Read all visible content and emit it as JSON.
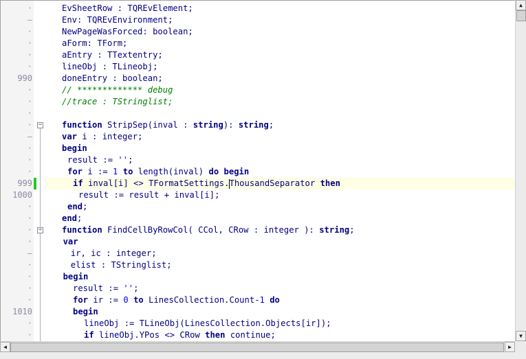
{
  "editor": {
    "lines": [
      {
        "num": "",
        "marker": "·",
        "indent": 1,
        "tokens": [
          [
            "id",
            "EvSheetRow : TQREvElement;"
          ]
        ]
      },
      {
        "num": "",
        "marker": "–",
        "indent": 1,
        "tokens": [
          [
            "id",
            "Env: TQREvEnvironment;"
          ]
        ]
      },
      {
        "num": "",
        "marker": "·",
        "indent": 1,
        "tokens": [
          [
            "id",
            "NewPageWasForced: boolean;"
          ]
        ]
      },
      {
        "num": "",
        "marker": "·",
        "indent": 1,
        "tokens": [
          [
            "id",
            "aForm: TForm;"
          ]
        ]
      },
      {
        "num": "",
        "marker": "·",
        "indent": 1,
        "tokens": [
          [
            "id",
            "aEntry : TTextentry;"
          ]
        ]
      },
      {
        "num": "",
        "marker": "·",
        "indent": 1,
        "tokens": [
          [
            "id",
            "lineObj : TLineobj;"
          ]
        ]
      },
      {
        "num": "990",
        "marker": "",
        "indent": 1,
        "tokens": [
          [
            "id",
            "doneEntry : boolean;"
          ]
        ]
      },
      {
        "num": "",
        "marker": "·",
        "indent": 1,
        "tokens": [
          [
            "cmt",
            "// ************* debug"
          ]
        ]
      },
      {
        "num": "",
        "marker": "·",
        "indent": 1,
        "tokens": [
          [
            "cmt",
            "//trace : TStringlist;"
          ]
        ]
      },
      {
        "num": "",
        "marker": "·",
        "indent": 0,
        "tokens": []
      },
      {
        "num": "",
        "marker": "·",
        "indent": 1,
        "fold": "−",
        "tokens": [
          [
            "kw",
            "function"
          ],
          [
            "id",
            " StripSep(inval : "
          ],
          [
            "kw",
            "string"
          ],
          [
            "id",
            "): "
          ],
          [
            "kw",
            "string"
          ],
          [
            "id",
            ";"
          ]
        ]
      },
      {
        "num": "",
        "marker": "–",
        "indent": 1,
        "tokens": [
          [
            "kw",
            "var"
          ],
          [
            "id",
            " i : integer;"
          ]
        ]
      },
      {
        "num": "",
        "marker": "·",
        "indent": 1,
        "tokens": [
          [
            "kw",
            "begin"
          ]
        ]
      },
      {
        "num": "",
        "marker": "·",
        "indent": 2,
        "tokens": [
          [
            "id",
            "result := "
          ],
          [
            "str",
            "''"
          ],
          [
            "id",
            ";"
          ]
        ]
      },
      {
        "num": "",
        "marker": "·",
        "indent": 2,
        "tokens": [
          [
            "kw",
            "for"
          ],
          [
            "id",
            " i := "
          ],
          [
            "num",
            "1"
          ],
          [
            "id",
            " "
          ],
          [
            "kw",
            "to"
          ],
          [
            "id",
            " length(inval) "
          ],
          [
            "kw",
            "do"
          ],
          [
            "id",
            " "
          ],
          [
            "kw",
            "begin"
          ]
        ]
      },
      {
        "num": "999",
        "marker": "",
        "indent": 3,
        "highlight": true,
        "change": true,
        "tokens": [
          [
            "kw",
            "if"
          ],
          [
            "id",
            " inval[i] <> TFormatSettings."
          ],
          [
            "caret",
            ""
          ],
          [
            "id",
            "ThousandSeparator "
          ],
          [
            "kw",
            "then"
          ]
        ]
      },
      {
        "num": "1000",
        "marker": "",
        "indent": 4,
        "tokens": [
          [
            "id",
            "result := result + inval[i];"
          ]
        ]
      },
      {
        "num": "",
        "marker": "·",
        "indent": 2,
        "tokens": [
          [
            "kw",
            "end"
          ],
          [
            "id",
            ";"
          ]
        ]
      },
      {
        "num": "",
        "marker": "·",
        "indent": 1,
        "tokens": [
          [
            "kw",
            "end"
          ],
          [
            "id",
            ";"
          ]
        ]
      },
      {
        "num": "",
        "marker": "·",
        "indent": 1,
        "fold": "−",
        "tokens": [
          [
            "kw",
            "function"
          ],
          [
            "id",
            " FindCellByRowCol( CCol, CRow : integer ): "
          ],
          [
            "kw",
            "string"
          ],
          [
            "id",
            ";"
          ]
        ]
      },
      {
        "num": "",
        "marker": "·",
        "indent": 1.2,
        "tokens": [
          [
            "kw",
            "var"
          ]
        ]
      },
      {
        "num": "",
        "marker": "–",
        "indent": 2.6,
        "tokens": [
          [
            "id",
            "ir, ic : integer;"
          ]
        ]
      },
      {
        "num": "",
        "marker": "·",
        "indent": 2.6,
        "tokens": [
          [
            "id",
            "elist : TStringlist;"
          ]
        ]
      },
      {
        "num": "",
        "marker": "·",
        "indent": 1.2,
        "tokens": [
          [
            "kw",
            "begin"
          ]
        ]
      },
      {
        "num": "",
        "marker": "·",
        "indent": 3,
        "tokens": [
          [
            "id",
            "result := "
          ],
          [
            "str",
            "''"
          ],
          [
            "id",
            ";"
          ]
        ]
      },
      {
        "num": "",
        "marker": "·",
        "indent": 3,
        "tokens": [
          [
            "kw",
            "for"
          ],
          [
            "id",
            " ir := "
          ],
          [
            "num",
            "0"
          ],
          [
            "id",
            " "
          ],
          [
            "kw",
            "to"
          ],
          [
            "id",
            " LinesCollection.Count-"
          ],
          [
            "num",
            "1"
          ],
          [
            "id",
            " "
          ],
          [
            "kw",
            "do"
          ]
        ]
      },
      {
        "num": "1010",
        "marker": "",
        "indent": 3,
        "tokens": [
          [
            "kw",
            "begin"
          ]
        ]
      },
      {
        "num": "",
        "marker": "·",
        "indent": 5,
        "tokens": [
          [
            "id",
            "lineObj := TLineObj(LinesCollection.Objects[ir]);"
          ]
        ]
      },
      {
        "num": "",
        "marker": "·",
        "indent": 5,
        "tokens": [
          [
            "kw",
            "if"
          ],
          [
            "id",
            " lineObj.YPos <> CRow "
          ],
          [
            "kw",
            "then"
          ],
          [
            "id",
            " continue;"
          ]
        ]
      }
    ]
  },
  "scrollbars": {
    "up_arrow": "▲",
    "down_arrow": "▼",
    "left_arrow": "◀",
    "right_arrow": "▶"
  }
}
